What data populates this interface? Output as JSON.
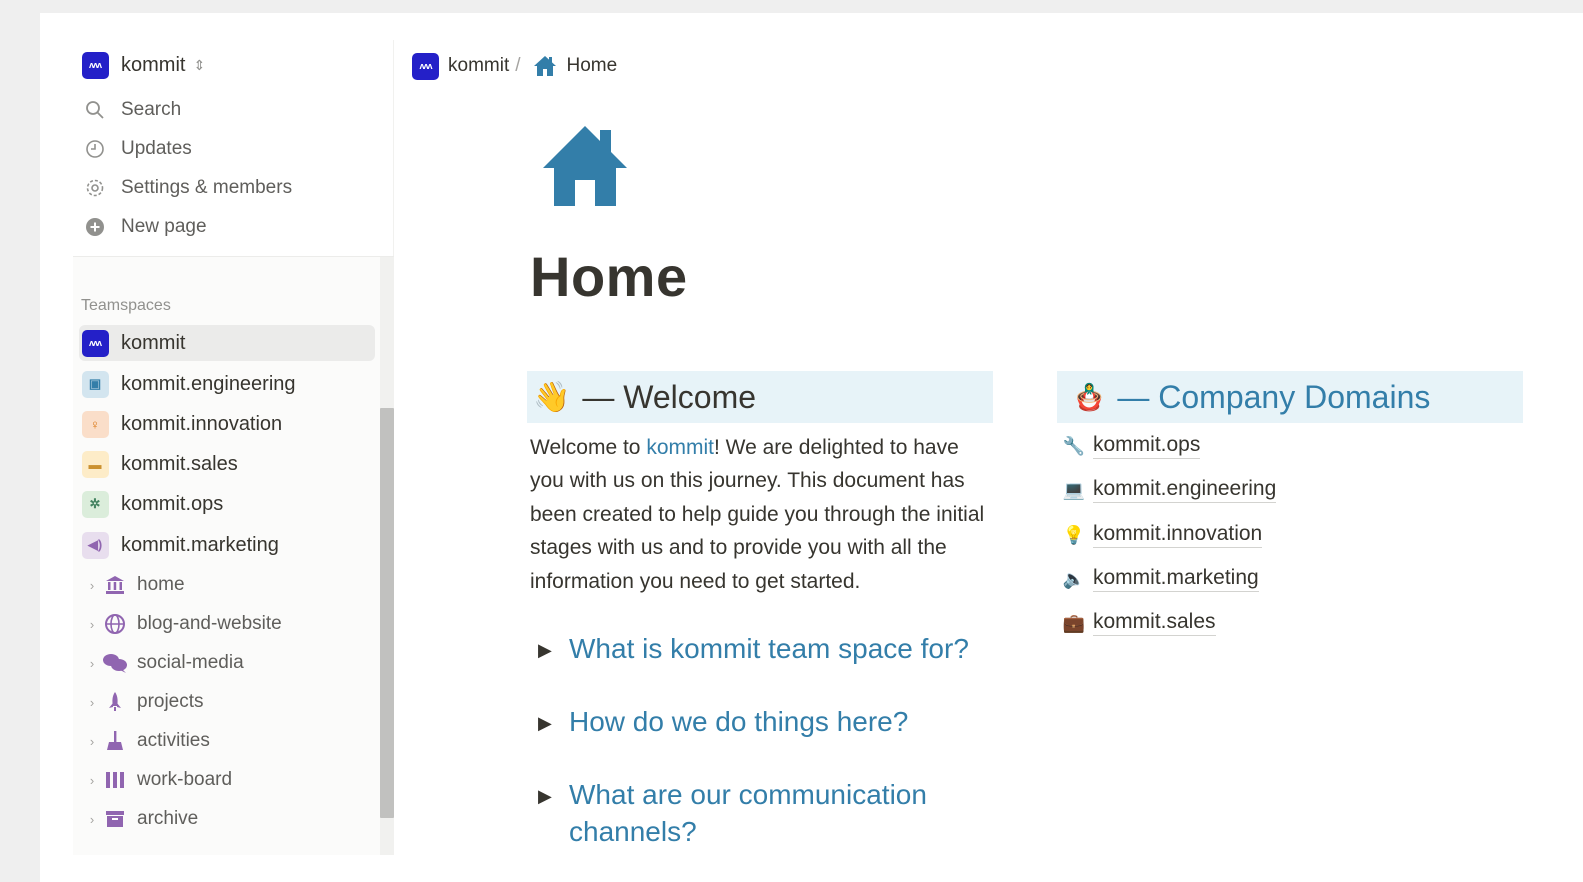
{
  "workspace": {
    "name": "kommit",
    "badge": "ʌʌʌ"
  },
  "sidebar": {
    "top_items": [
      {
        "label": "Search",
        "icon": "search-icon"
      },
      {
        "label": "Updates",
        "icon": "clock-icon"
      },
      {
        "label": "Settings & members",
        "icon": "gear-icon"
      },
      {
        "label": "New page",
        "icon": "plus-circle-icon"
      }
    ],
    "section_label": "Teamspaces",
    "teamspaces": [
      {
        "label": "kommit",
        "icon": "kommit-logo-icon",
        "color": "#2420c8"
      },
      {
        "label": "kommit.engineering",
        "icon": "chip-icon",
        "color": "#d3e5ef"
      },
      {
        "label": "kommit.innovation",
        "icon": "bulb-icon",
        "color": "#fadec9"
      },
      {
        "label": "kommit.sales",
        "icon": "store-icon",
        "color": "#fdecc8"
      },
      {
        "label": "kommit.ops",
        "icon": "bug-icon",
        "color": "#dbeddb"
      },
      {
        "label": "kommit.marketing",
        "icon": "megaphone-icon",
        "color": "#e8deee"
      }
    ],
    "pages": [
      {
        "label": "home",
        "icon": "bank-icon"
      },
      {
        "label": "blog-and-website",
        "icon": "globe-icon"
      },
      {
        "label": "social-media",
        "icon": "chat-bubbles-icon"
      },
      {
        "label": "projects",
        "icon": "rocket-icon"
      },
      {
        "label": "activities",
        "icon": "broom-icon"
      },
      {
        "label": "work-board",
        "icon": "columns-icon"
      },
      {
        "label": "archive",
        "icon": "archive-box-icon"
      }
    ]
  },
  "breadcrumb": {
    "workspace": "kommit",
    "separator": "/",
    "page": "Home"
  },
  "page": {
    "title": "Home",
    "welcome": {
      "heading": "— Welcome",
      "emoji": "👋",
      "text_before": "Welcome to ",
      "link": "kommit",
      "text_after": "! We are delighted to have you with us on this journey. This document has been created to help guide you through the initial stages with us and to provide you with all the information you need to get started."
    },
    "toggles": [
      "What is kommit team space for?",
      "How do we do things here?",
      "What are our communication channels?"
    ],
    "domains": {
      "heading": "— Company Domains",
      "emoji": "🪆",
      "items": [
        {
          "label": "kommit.ops",
          "icon": "wrench-icon",
          "glyph": "🔧"
        },
        {
          "label": "kommit.engineering",
          "icon": "laptop-icon",
          "glyph": "💻"
        },
        {
          "label": "kommit.innovation",
          "icon": "bulb-icon",
          "glyph": "💡"
        },
        {
          "label": "kommit.marketing",
          "icon": "speaker-icon",
          "glyph": "🔈"
        },
        {
          "label": "kommit.sales",
          "icon": "briefcase-icon",
          "glyph": "💼"
        }
      ]
    }
  },
  "colors": {
    "accent": "#337ea9",
    "callout_bg": "#e7f3f8",
    "page_icon": "#337ea9",
    "page_icon_purple": "#9065b0"
  }
}
